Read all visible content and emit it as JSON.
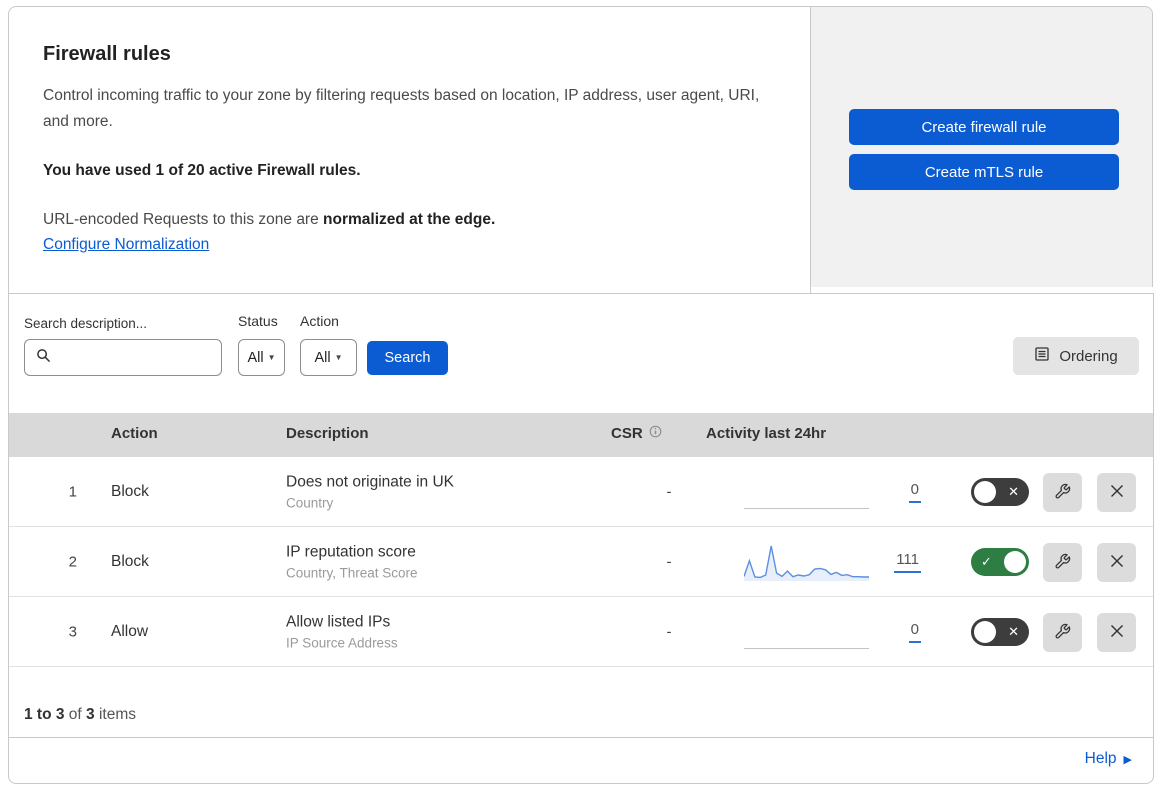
{
  "intro": {
    "title": "Firewall rules",
    "description": "Control incoming traffic to your zone by filtering requests based on location, IP address, user agent, URI, and more.",
    "usage": "You have used 1 of 20 active Firewall rules.",
    "normalization_text": "URL-encoded Requests to this zone are",
    "normalization_bold": "normalized at the edge.",
    "normalization_link": "Configure Normalization"
  },
  "side_panel": {
    "create_firewall_rule": "Create firewall rule",
    "create_mtls_rule": "Create mTLS rule"
  },
  "filters": {
    "search_label": "Search description...",
    "status_label": "Status",
    "status_value": "All",
    "action_label": "Action",
    "action_value": "All",
    "search_button": "Search",
    "ordering_button": "Ordering"
  },
  "table": {
    "headers": {
      "action": "Action",
      "description": "Description",
      "csr": "CSR",
      "activity": "Activity last 24hr"
    },
    "rows": [
      {
        "num": "1",
        "action": "Block",
        "title": "Does not originate in UK",
        "subtitle": "Country",
        "csr": "-",
        "count": "0",
        "enabled": false
      },
      {
        "num": "2",
        "action": "Block",
        "title": "IP reputation score",
        "subtitle": "Country, Threat Score",
        "csr": "-",
        "count": "111",
        "enabled": true,
        "sparkline": [
          8,
          55,
          6,
          5,
          12,
          100,
          18,
          8,
          24,
          7,
          12,
          9,
          13,
          30,
          32,
          28,
          14,
          20,
          11,
          13,
          7,
          7,
          6,
          6
        ]
      },
      {
        "num": "3",
        "action": "Allow",
        "title": "Allow listed IPs",
        "subtitle": "IP Source Address",
        "csr": "-",
        "count": "0",
        "enabled": false
      }
    ]
  },
  "footer": {
    "range": "1 to 3",
    "of": "of",
    "total": "3",
    "items": "items",
    "help": "Help"
  },
  "colors": {
    "primary_blue": "#0b5bd3",
    "link_blue": "#0b5bd3",
    "toggle_on_green": "#2e7d43",
    "toggle_off_gray": "#3d3d3d",
    "table_header_gray": "#d9d9d9",
    "side_panel_gray": "#f1f1f1",
    "sparkline_blue": "#5b8fe0"
  }
}
